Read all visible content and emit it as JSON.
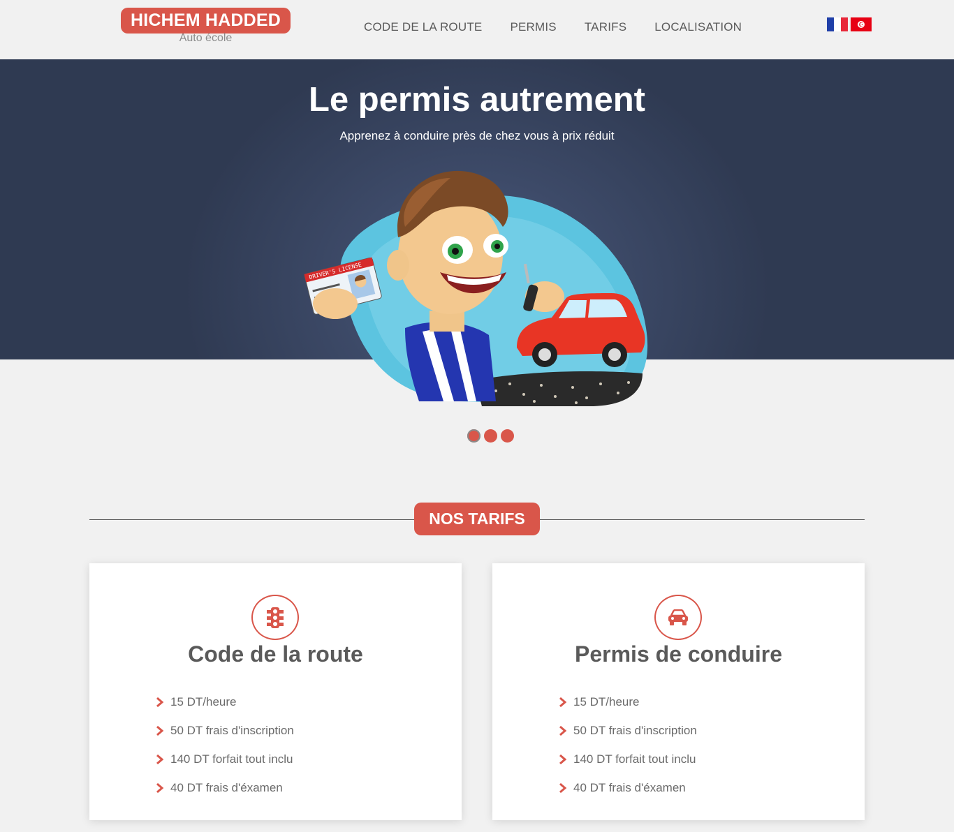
{
  "header": {
    "logo_title": "HICHEM HADDED",
    "logo_subtitle": "Auto école",
    "nav": [
      "CODE DE LA ROUTE",
      "PERMIS",
      "TARIFS",
      "LOCALISATION"
    ],
    "languages": [
      "french-flag-icon",
      "tunisian-flag-icon"
    ]
  },
  "hero": {
    "title": "Le permis autrement",
    "subtitle": "Apprenez à conduire près de chez vous à prix réduit",
    "carousel_slides": 3,
    "active_slide": 1
  },
  "pricing": {
    "section_title": "NOS TARIFS",
    "cards": [
      {
        "icon": "traffic-light-icon",
        "title": "Code de la route",
        "items": [
          "15 DT/heure",
          "50 DT frais d'inscription",
          "140 DT forfait tout inclu",
          "40 DT frais d'éxamen"
        ]
      },
      {
        "icon": "car-icon",
        "title": "Permis de conduire",
        "items": [
          "15 DT/heure",
          "50 DT frais d'inscription",
          "140 DT forfait tout inclu",
          "40 DT frais d'éxamen"
        ]
      }
    ]
  },
  "colors": {
    "accent": "#d9564a",
    "hero_bg": "#2f3a52",
    "page_bg": "#f1f1f1"
  }
}
